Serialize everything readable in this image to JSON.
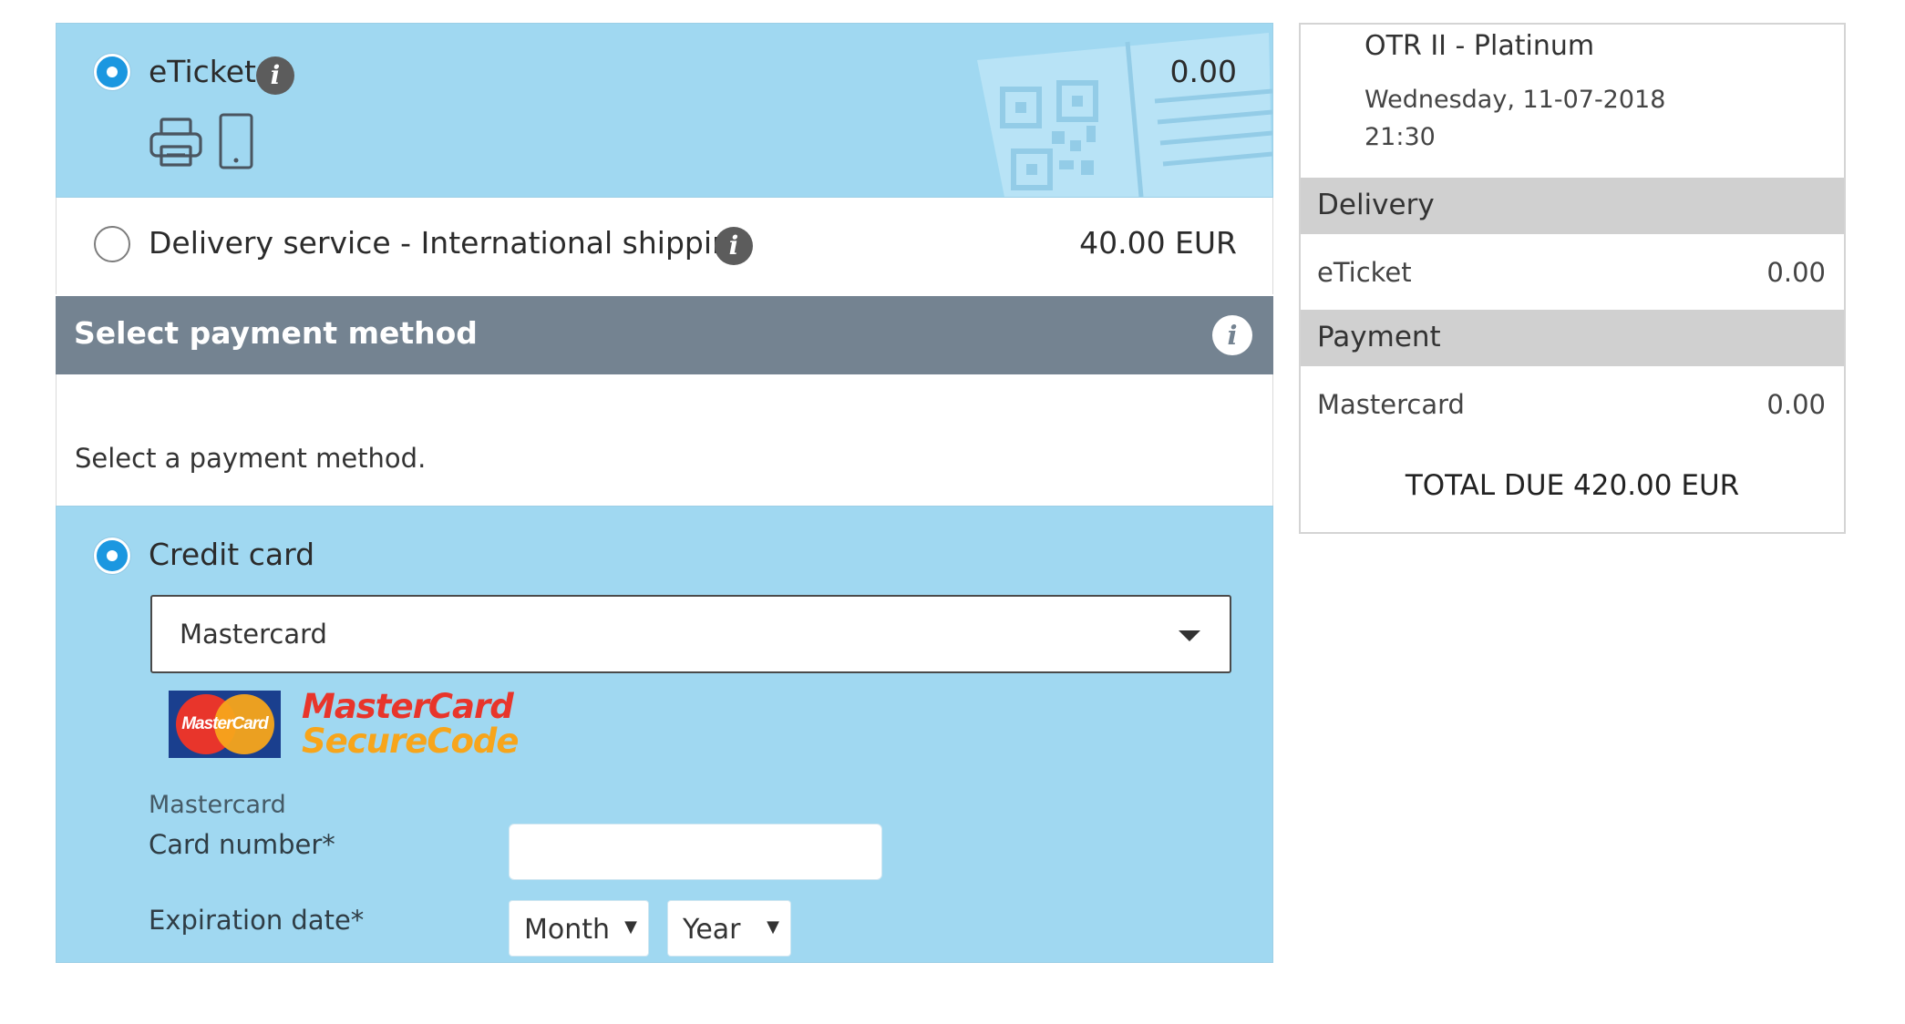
{
  "delivery_options": [
    {
      "label": "eTicket",
      "price": "0.00",
      "selected": true
    },
    {
      "label": "Delivery service - International shipping",
      "price": "40.00 EUR",
      "selected": false
    }
  ],
  "icons": {
    "info": "i",
    "eticket_icons": [
      "printer-icon",
      "smartphone-icon"
    ]
  },
  "payment_section": {
    "header": "Select payment method",
    "instruction": "Select a payment method."
  },
  "credit_card": {
    "label": "Credit card",
    "selected": true,
    "card_type_selected": "Mastercard",
    "logo_text_1": "MasterCard",
    "logo_text_2": "SecureCode",
    "logo_badge": "MasterCard",
    "card_brand_label": "Mastercard",
    "card_number_label": "Card number*",
    "card_number_value": "",
    "expiration_label": "Expiration date*",
    "month_selected": "Month",
    "year_selected": "Year"
  },
  "summary": {
    "event_title": "OTR II - Platinum",
    "event_date": "Wednesday, 11-07-2018",
    "event_time": "21:30",
    "delivery_header": "Delivery",
    "delivery_item": "eTicket",
    "delivery_price": "0.00",
    "payment_header": "Payment",
    "payment_item": "Mastercard",
    "payment_price": "0.00",
    "total": "TOTAL DUE 420.00 EUR"
  },
  "colors": {
    "selected_bg": "#a0d8f1",
    "header_bg": "#748391",
    "radio_on": "#1b97e0",
    "summary_band": "#d0d0d0",
    "mc_red": "#e8352b",
    "mc_orange": "#f7a51b",
    "mc_blue": "#1a3f8e"
  }
}
